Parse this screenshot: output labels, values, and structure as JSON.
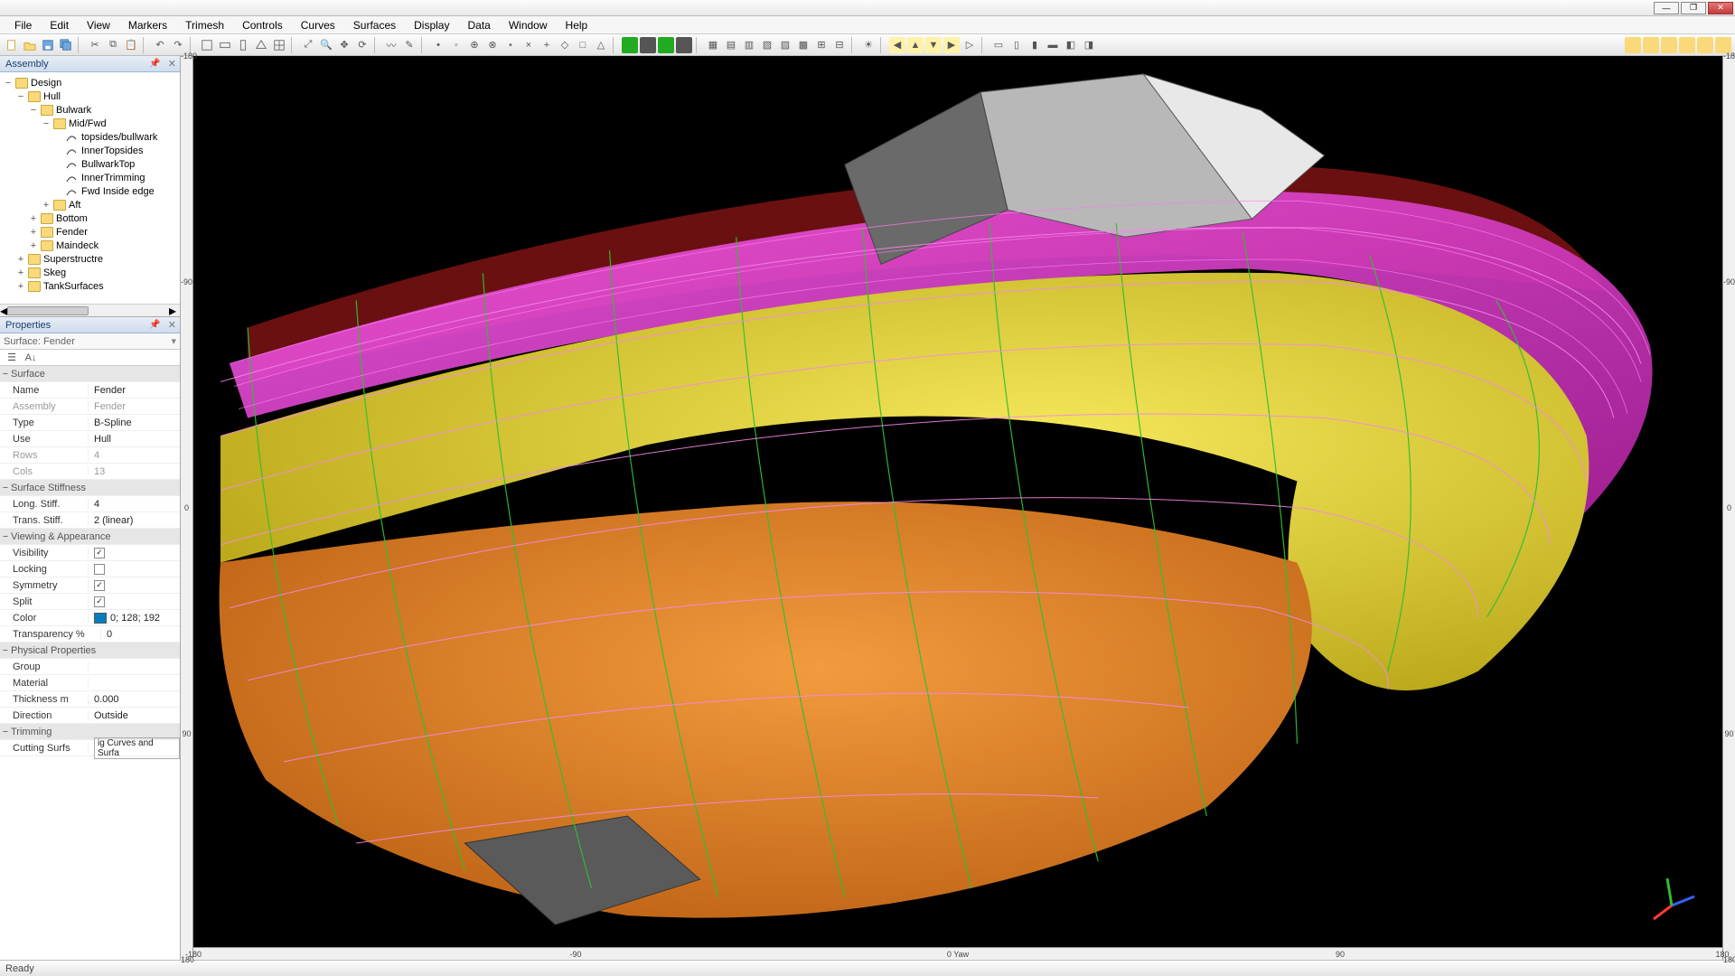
{
  "menu": {
    "items": [
      "File",
      "Edit",
      "View",
      "Markers",
      "Trimesh",
      "Controls",
      "Curves",
      "Surfaces",
      "Display",
      "Data",
      "Window",
      "Help"
    ]
  },
  "panels": {
    "assembly": "Assembly",
    "properties": "Properties"
  },
  "tree": [
    {
      "ind": 0,
      "tog": "−",
      "label": "Design",
      "icon": "folder"
    },
    {
      "ind": 1,
      "tog": "−",
      "label": "Hull",
      "icon": "folder"
    },
    {
      "ind": 2,
      "tog": "−",
      "label": "Bulwark",
      "icon": "folder"
    },
    {
      "ind": 3,
      "tog": "−",
      "label": "Mid/Fwd",
      "icon": "folder"
    },
    {
      "ind": 4,
      "tog": "",
      "label": "topsides/bullwark",
      "icon": "curve"
    },
    {
      "ind": 4,
      "tog": "",
      "label": "InnerTopsides",
      "icon": "curve"
    },
    {
      "ind": 4,
      "tog": "",
      "label": "BullwarkTop",
      "icon": "curve"
    },
    {
      "ind": 4,
      "tog": "",
      "label": "InnerTrimming",
      "icon": "curve"
    },
    {
      "ind": 4,
      "tog": "",
      "label": "Fwd Inside edge",
      "icon": "curve"
    },
    {
      "ind": 3,
      "tog": "+",
      "label": "Aft",
      "icon": "folder"
    },
    {
      "ind": 2,
      "tog": "+",
      "label": "Bottom",
      "icon": "folder"
    },
    {
      "ind": 2,
      "tog": "+",
      "label": "Fender",
      "icon": "folder"
    },
    {
      "ind": 2,
      "tog": "+",
      "label": "Maindeck",
      "icon": "folder"
    },
    {
      "ind": 1,
      "tog": "+",
      "label": "Superstructre",
      "icon": "folder"
    },
    {
      "ind": 1,
      "tog": "+",
      "label": "Skeg",
      "icon": "folder"
    },
    {
      "ind": 1,
      "tog": "+",
      "label": "TankSurfaces",
      "icon": "folder"
    }
  ],
  "propSelector": "Surface: Fender",
  "props": {
    "cat_surface": "Surface",
    "name_k": "Name",
    "name_v": "Fender",
    "assembly_k": "Assembly",
    "assembly_v": "Fender",
    "type_k": "Type",
    "type_v": "B-Spline",
    "use_k": "Use",
    "use_v": "Hull",
    "rows_k": "Rows",
    "rows_v": "4",
    "cols_k": "Cols",
    "cols_v": "13",
    "cat_stiff": "Surface Stiffness",
    "long_k": "Long. Stiff.",
    "long_v": "4",
    "trans_k": "Trans. Stiff.",
    "trans_v": "2 (linear)",
    "cat_view": "Viewing & Appearance",
    "vis_k": "Visibility",
    "lock_k": "Locking",
    "sym_k": "Symmetry",
    "split_k": "Split",
    "color_k": "Color",
    "color_v": "0; 128; 192",
    "transp_k": "Transparency %",
    "transp_v": "0",
    "cat_phys": "Physical Properties",
    "group_k": "Group",
    "group_v": "",
    "mat_k": "Material",
    "mat_v": "",
    "thick_k": "Thickness m",
    "thick_v": "0.000",
    "dir_k": "Direction",
    "dir_v": "Outside",
    "cat_trim": "Trimming",
    "cut_k": "Cutting Surfs",
    "cut_v": "ig Curves and Surfa"
  },
  "rulers": {
    "v": [
      {
        "p": 0,
        "t": "-180"
      },
      {
        "p": 25,
        "t": "-90"
      },
      {
        "p": 50,
        "t": "0"
      },
      {
        "p": 75,
        "t": "90"
      },
      {
        "p": 100,
        "t": "180"
      }
    ],
    "h": [
      {
        "p": 0,
        "t": "-180"
      },
      {
        "p": 25,
        "t": "-90"
      },
      {
        "p": 50,
        "t": "0 Yaw"
      },
      {
        "p": 75,
        "t": "90"
      },
      {
        "p": 100,
        "t": "180"
      }
    ]
  },
  "status": "Ready",
  "colors": {
    "hull_yellow": "#e8d22e",
    "hull_orange": "#e07a1f",
    "hull_magenta": "#e23bd0",
    "hull_red": "#8a1414",
    "grid_green": "#2fbf2f",
    "grid_pink": "#f488e8",
    "super_gray": "#777"
  }
}
